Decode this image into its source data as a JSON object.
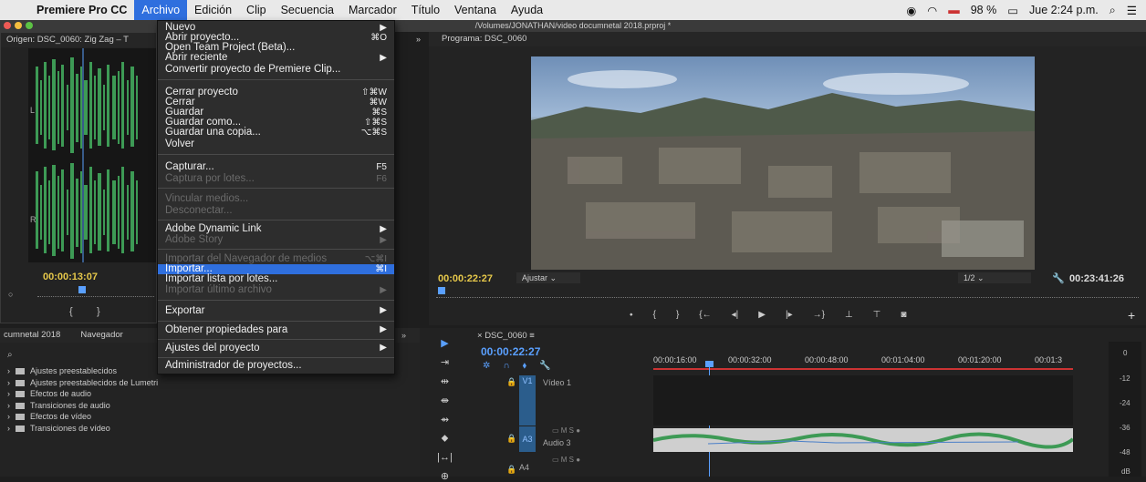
{
  "menubar": {
    "app": "Premiere Pro CC",
    "items": [
      "Archivo",
      "Edición",
      "Clip",
      "Secuencia",
      "Marcador",
      "Título",
      "Ventana",
      "Ayuda"
    ],
    "battery": "98 %",
    "clock": "Jue 2:24 p.m."
  },
  "window": {
    "title": "/Volumes/JONATHAN/video documnetal 2018.prproj *"
  },
  "source": {
    "title": "Origen: DSC_0060: Zig Zag – T",
    "timecode": "00:00:13:07",
    "ch_l": "L",
    "ch_r": "R"
  },
  "program": {
    "title": "Programa: DSC_0060",
    "timecode": "00:00:22:27",
    "fit": "Ajustar",
    "resolution": "1/2",
    "duration": "00:23:41:26"
  },
  "project": {
    "tab1": "cumnetal 2018",
    "tab2": "Navegador",
    "items": [
      "Ajustes preestablecidos",
      "Ajustes preestablecidos de Lumetri",
      "Efectos de audio",
      "Transiciones de audio",
      "Efectos de vídeo",
      "Transiciones de vídeo"
    ]
  },
  "timeline": {
    "tab": "DSC_0060",
    "timecode": "00:00:22:27",
    "ruler": [
      "00:00:16:00",
      "00:00:32:00",
      "00:00:48:00",
      "00:01:04:00",
      "00:01:20:00",
      "00:01:3"
    ],
    "tracks": [
      {
        "id": "V1",
        "name": "Vídeo 1"
      },
      {
        "id": "A3",
        "name": "Audio 3"
      },
      {
        "id": "A4",
        "name": ""
      }
    ],
    "meter": [
      "0",
      "-12",
      "-24",
      "-36",
      "-48",
      "dB"
    ]
  },
  "menu": {
    "items": [
      {
        "label": "Nuevo",
        "shortcut": "",
        "arrow": true,
        "disabled": false
      },
      {
        "label": "Abrir proyecto...",
        "shortcut": "⌘O",
        "arrow": false,
        "disabled": false
      },
      {
        "label": "Open Team Project (Beta)...",
        "shortcut": "",
        "arrow": false,
        "disabled": false
      },
      {
        "label": "Abrir reciente",
        "shortcut": "",
        "arrow": true,
        "disabled": false
      },
      {
        "label": "Convertir proyecto de Premiere Clip...",
        "shortcut": "",
        "arrow": false,
        "disabled": false
      },
      {
        "label": "Cerrar proyecto",
        "shortcut": "⇧⌘W",
        "arrow": false,
        "disabled": false
      },
      {
        "label": "Cerrar",
        "shortcut": "⌘W",
        "arrow": false,
        "disabled": false
      },
      {
        "label": "Guardar",
        "shortcut": "⌘S",
        "arrow": false,
        "disabled": false
      },
      {
        "label": "Guardar como...",
        "shortcut": "⇧⌘S",
        "arrow": false,
        "disabled": false
      },
      {
        "label": "Guardar una copia...",
        "shortcut": "⌥⌘S",
        "arrow": false,
        "disabled": false
      },
      {
        "label": "Volver",
        "shortcut": "",
        "arrow": false,
        "disabled": false
      },
      {
        "label": "Capturar...",
        "shortcut": "F5",
        "arrow": false,
        "disabled": false
      },
      {
        "label": "Captura por lotes...",
        "shortcut": "F6",
        "arrow": false,
        "disabled": true
      },
      {
        "label": "Vincular medios...",
        "shortcut": "",
        "arrow": false,
        "disabled": true
      },
      {
        "label": "Desconectar...",
        "shortcut": "",
        "arrow": false,
        "disabled": true
      },
      {
        "label": "Adobe Dynamic Link",
        "shortcut": "",
        "arrow": true,
        "disabled": false
      },
      {
        "label": "Adobe Story",
        "shortcut": "",
        "arrow": true,
        "disabled": true
      },
      {
        "label": "Importar del Navegador de medios",
        "shortcut": "⌥⌘I",
        "arrow": false,
        "disabled": true
      },
      {
        "label": "Importar...",
        "shortcut": "⌘I",
        "arrow": false,
        "disabled": false
      },
      {
        "label": "Importar lista por lotes...",
        "shortcut": "",
        "arrow": false,
        "disabled": false
      },
      {
        "label": "Importar último archivo",
        "shortcut": "",
        "arrow": true,
        "disabled": true
      },
      {
        "label": "Exportar",
        "shortcut": "",
        "arrow": true,
        "disabled": false
      },
      {
        "label": "Obtener propiedades para",
        "shortcut": "",
        "arrow": true,
        "disabled": false
      },
      {
        "label": "Ajustes del proyecto",
        "shortcut": "",
        "arrow": true,
        "disabled": false
      },
      {
        "label": "Administrador de proyectos...",
        "shortcut": "",
        "arrow": false,
        "disabled": false
      }
    ]
  },
  "colors": {
    "accent": "#2f6fde",
    "timecode": "#5aa0ff",
    "waveform": "#3d9a55",
    "track_selected": "#2b5d8c"
  }
}
